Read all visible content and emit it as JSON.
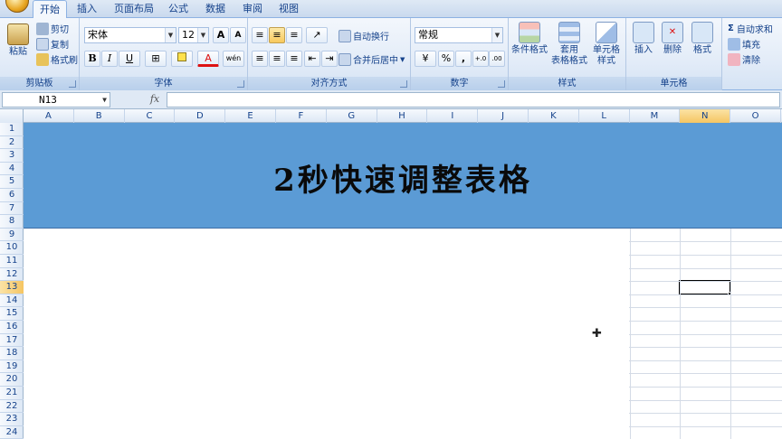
{
  "tabs": [
    "开始",
    "插入",
    "页面布局",
    "公式",
    "数据",
    "审阅",
    "视图"
  ],
  "active_tab": "开始",
  "clipboard": {
    "paste": "粘贴",
    "cut": "剪切",
    "copy": "复制",
    "format_painter": "格式刷",
    "label": "剪贴板"
  },
  "font": {
    "name": "宋体",
    "size": "12",
    "label": "字体",
    "bold": "B",
    "italic": "I",
    "underline": "U",
    "grow": "A",
    "shrink": "A",
    "color_letter": "A",
    "phonetic": "wén"
  },
  "alignment": {
    "wrap_text": "自动换行",
    "merge_center": "合并后居中",
    "label": "对齐方式"
  },
  "number": {
    "format": "常规",
    "percent": "%",
    "comma": ",",
    "inc_decimal": ".0→.00",
    "dec_decimal": ".00→.0",
    "label": "数字"
  },
  "styles": {
    "conditional": "条件格式",
    "table_line1": "套用",
    "table_line2": "表格格式",
    "cell_line1": "单元格",
    "cell_line2": "样式",
    "label": "样式"
  },
  "cells_group": {
    "insert": "插入",
    "delete": "删除",
    "format": "格式",
    "label": "单元格"
  },
  "editing": {
    "autosum": "自动求和",
    "fill": "填充",
    "clear": "清除",
    "sigma": "Σ"
  },
  "formula_bar": {
    "name_box": "N13",
    "fx": "fx",
    "content": ""
  },
  "columns": [
    "A",
    "B",
    "C",
    "D",
    "E",
    "F",
    "G",
    "H",
    "I",
    "J",
    "K",
    "L",
    "M",
    "N",
    "O"
  ],
  "rows": [
    "1",
    "2",
    "3",
    "4",
    "5",
    "6",
    "7",
    "8",
    "9",
    "10",
    "11",
    "12",
    "13",
    "14",
    "15",
    "16",
    "17",
    "18",
    "19",
    "20",
    "21",
    "22",
    "23",
    "24"
  ],
  "selected_column": "N",
  "selected_row": "13",
  "banner_title": "2秒快速调整表格",
  "colors": {
    "banner": "#5b9bd5",
    "ribbon": "#dfe9f5",
    "selection_header": "#f5c562"
  }
}
